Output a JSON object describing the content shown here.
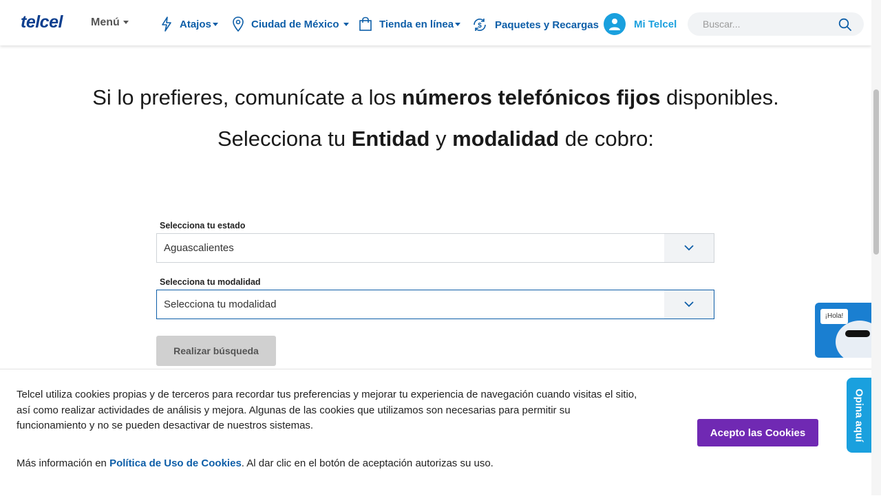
{
  "header": {
    "logo": "telcel",
    "menu_label": "Menú",
    "nav": {
      "atajos": "Atajos",
      "city": "Ciudad de México",
      "store": "Tienda en línea",
      "packages": "Paquetes y Recargas",
      "account": "Mi Telcel"
    },
    "search_placeholder": "Buscar..."
  },
  "main": {
    "heading1": {
      "pre": "Si lo prefieres, comunícate a los ",
      "bold": "números telefónicos fijos",
      "post": " disponibles."
    },
    "heading2": {
      "pre": "Selecciona tu ",
      "bold1": "Entidad",
      "mid": " y ",
      "bold2": "modalidad",
      "post": " de cobro:"
    },
    "state_label": "Selecciona tu estado",
    "state_value": "Aguascalientes",
    "mode_label": "Selecciona tu modalidad",
    "mode_value": "Selecciona tu modalidad",
    "search_button": "Realizar búsqueda"
  },
  "cookie": {
    "text": "Telcel utiliza cookies propias y de terceros para recordar tus preferencias y mejorar tu experiencia de navegación cuando visitas el sitio, así como realizar actividades de análisis y mejora. Algunas de las cookies que utilizamos son necesarias para permitir su funcionamiento y no se pueden desactivar de nuestros sistemas.",
    "more_pre": "Más información en ",
    "more_link": "Política de Uso de Cookies",
    "more_post": ". Al dar clic en el botón de aceptación autorizas su uso.",
    "accept": "Acepto las Cookies"
  },
  "chat": {
    "greeting": "¡Hola!"
  },
  "feedback": {
    "label": "Opina aquí"
  },
  "colors": {
    "brand_blue": "#0d5ea8",
    "light_blue": "#1aa0de",
    "purple": "#7029b3"
  }
}
